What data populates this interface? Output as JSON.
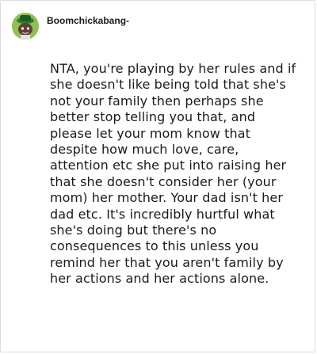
{
  "comment": {
    "author": "Boomchickabang-",
    "avatar_icon": "snoo-avatar-icon",
    "body": "NTA, you're playing by her rules and if she doesn't like being told that she's not your family then perhaps she better stop telling you that, and please let your mom know that despite how much love, care, attention etc she put into raising her that she doesn't consider her (your mom) her mother. Your dad isn't her dad etc. It's incredibly hurtful what she's doing but there's no consequences to this unless you remind her that you aren't family by her actions and her actions alone."
  },
  "colors": {
    "text": "#1a1a1a",
    "border": "#dcdcdc",
    "avatar_bg": "#8fbf55"
  }
}
